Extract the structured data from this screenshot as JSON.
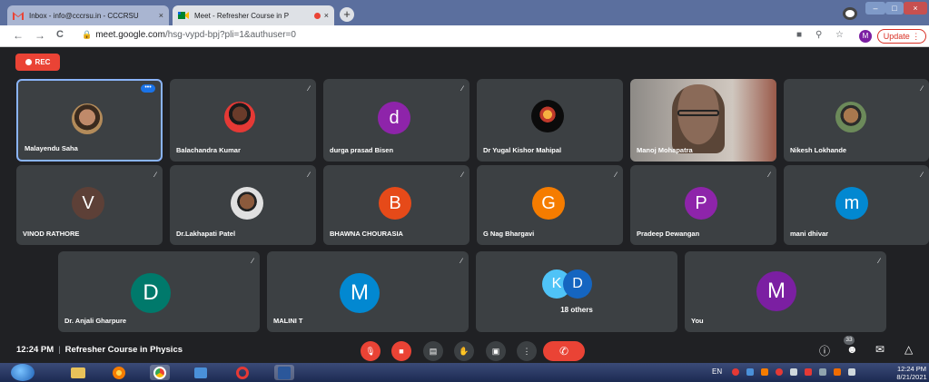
{
  "browser": {
    "tabs": [
      {
        "title": "Inbox - info@cccrsu.in - CCCRSU",
        "close": "×",
        "icon": "gmail-icon"
      },
      {
        "title": "Meet - Refresher Course in P",
        "close": "×",
        "icon": "meet-icon"
      }
    ],
    "new_tab": "+",
    "window_controls": {
      "minimize": "–",
      "maximize": "□",
      "close": "×"
    },
    "nav": {
      "back": "←",
      "forward": "→",
      "reload": "C"
    },
    "url_host": "meet.google.com",
    "url_path": "/hsg-vypd-bpj?pli=1&authuser=0",
    "profile_initial": "M",
    "update_label": "Update",
    "update_menu": "⋮"
  },
  "meet": {
    "rec_label": "REC",
    "participants": [
      {
        "name": "Malayendu Saha",
        "kind": "photo"
      },
      {
        "name": "Balachandra Kumar",
        "kind": "photo"
      },
      {
        "name": "durga prasad Bisen",
        "kind": "letter",
        "initial": "d",
        "color": "#8e24aa"
      },
      {
        "name": "Dr Yugal Kishor Mahipal",
        "kind": "photo"
      },
      {
        "name": "Manoj Mohapatra",
        "kind": "video"
      },
      {
        "name": "Nikesh Lokhande",
        "kind": "photo"
      },
      {
        "name": "VINOD RATHORE",
        "kind": "letter",
        "initial": "V",
        "color": "#5d4037"
      },
      {
        "name": "Dr.Lakhapati Patel",
        "kind": "photo"
      },
      {
        "name": "BHAWNA CHOURASIA",
        "kind": "letter",
        "initial": "B",
        "color": "#e64a19"
      },
      {
        "name": "G Nag Bhargavi",
        "kind": "letter",
        "initial": "G",
        "color": "#f57c00"
      },
      {
        "name": "Pradeep Dewangan",
        "kind": "letter",
        "initial": "P",
        "color": "#8e24aa"
      },
      {
        "name": "mani dhivar",
        "kind": "letter",
        "initial": "m",
        "color": "#0288d1"
      },
      {
        "name": "Dr. Anjali Gharpure",
        "kind": "letter",
        "initial": "D",
        "color": "#00796b"
      },
      {
        "name": "MALINI T",
        "kind": "letter",
        "initial": "M",
        "color": "#0288d1"
      },
      {
        "name": "18 others",
        "kind": "group",
        "initials": [
          "K",
          "D"
        ],
        "colors": [
          "#4fc3f7",
          "#1565c0"
        ]
      },
      {
        "name": "You",
        "kind": "letter",
        "initial": "M",
        "color": "#7b1fa2"
      }
    ],
    "time": "12:24 PM",
    "separator": "|",
    "meeting_title": "Refresher Course in Physics",
    "people_count": "33",
    "colors": {
      "background": "#202124",
      "tile": "#3c4043",
      "danger": "#ea4335",
      "highlight": "#8ab4f8"
    }
  },
  "taskbar": {
    "language": "EN",
    "clock_time": "12:24 PM",
    "clock_date": "8/21/2021"
  }
}
